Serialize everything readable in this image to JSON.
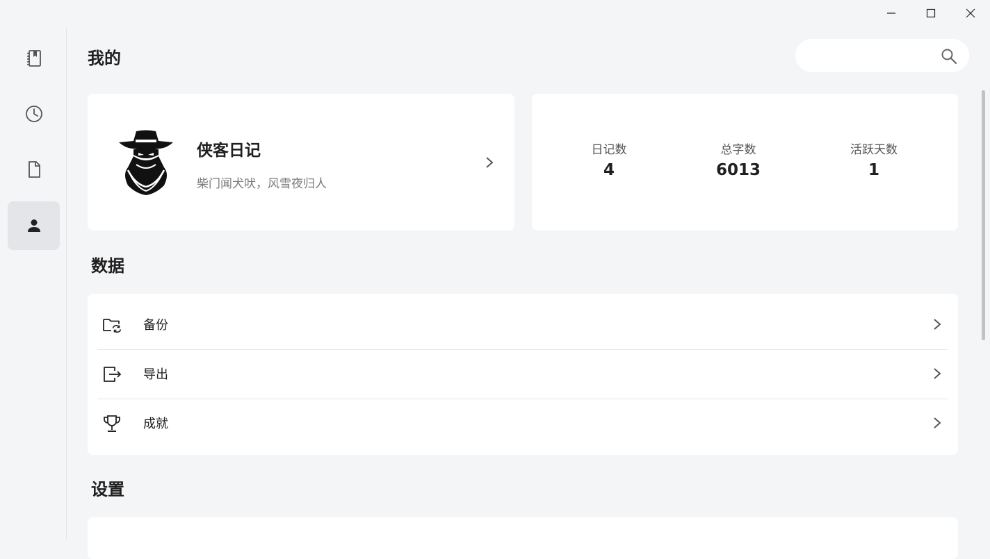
{
  "window": {
    "controls": [
      "minimize",
      "maximize",
      "close"
    ]
  },
  "sidebar": {
    "items": [
      {
        "name": "diary",
        "icon": "notebook-icon",
        "active": false
      },
      {
        "name": "history",
        "icon": "clock-icon",
        "active": false
      },
      {
        "name": "document",
        "icon": "document-icon",
        "active": false
      },
      {
        "name": "mine",
        "icon": "person-icon",
        "active": true
      }
    ]
  },
  "header": {
    "title": "我的",
    "search": {
      "value": "",
      "placeholder": ""
    }
  },
  "profile": {
    "name": "侠客日记",
    "motto": "柴门闻犬吠，风雪夜归人",
    "avatar_icon": "swordsman-avatar"
  },
  "stats": {
    "diary_count": {
      "label": "日记数",
      "value": "4"
    },
    "word_count": {
      "label": "总字数",
      "value": "6013"
    },
    "active_days": {
      "label": "活跃天数",
      "value": "1"
    }
  },
  "data_section": {
    "title": "数据",
    "items": [
      {
        "label": "备份",
        "icon": "folder-sync-icon"
      },
      {
        "label": "导出",
        "icon": "export-icon"
      },
      {
        "label": "成就",
        "icon": "trophy-icon"
      }
    ]
  },
  "settings_section": {
    "title": "设置"
  }
}
